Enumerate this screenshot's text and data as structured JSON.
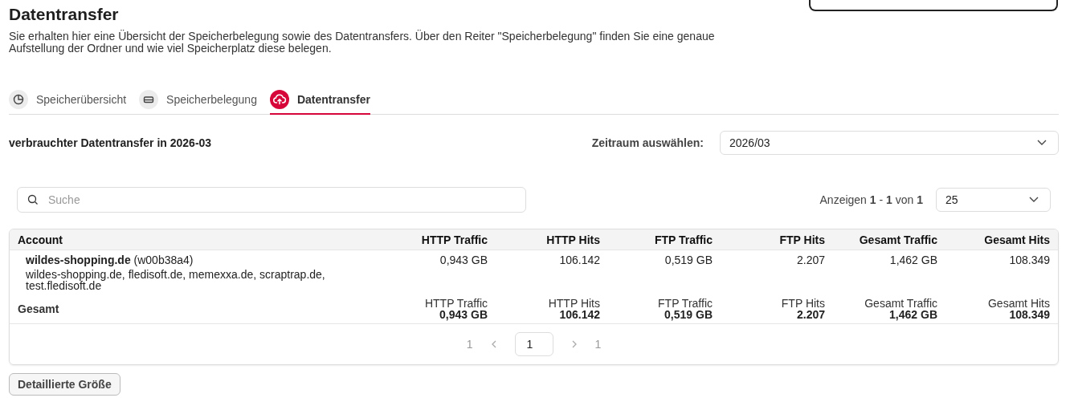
{
  "page": {
    "title": "Datentransfer",
    "description": "Sie erhalten hier eine Übersicht der Speicherbelegung sowie des Datentransfers. Über den Reiter \"Speicherbelegung\" finden Sie eine genaue Aufstellung der Ordner und wie viel Speicherplatz diese belegen."
  },
  "tabs": [
    {
      "label": "Speicherübersicht",
      "kind": "pie",
      "selected": false
    },
    {
      "label": "Speicherbelegung",
      "kind": "drive",
      "selected": false
    },
    {
      "label": "Datentransfer",
      "kind": "upload",
      "selected": true
    }
  ],
  "section": {
    "heading": "verbrauchter Datentransfer in 2026-03",
    "period_label": "Zeitraum auswählen:",
    "period_value": "2026/03"
  },
  "search": {
    "placeholder": "Suche"
  },
  "paging": {
    "summary": "Anzeigen **1** - **1** von **1**",
    "page_size": "25"
  },
  "table": {
    "columns": [
      "Account",
      "HTTP Traffic",
      "HTTP Hits",
      "FTP Traffic",
      "FTP Hits",
      "Gesamt Traffic",
      "Gesamt Hits"
    ],
    "rows": [
      {
        "account": "wildes-shopping.de",
        "id": "(w00b38a4)",
        "domains": "wildes-shopping.de, fledisoft.de, memexxa.de, scraptrap.de, test.fledisoft.de",
        "values": [
          "0,943 GB",
          "106.142",
          "0,519 GB",
          "2.207",
          "1,462 GB",
          "108.349"
        ]
      }
    ],
    "totals": {
      "label": "Gesamt",
      "cells": [
        {
          "label": "HTTP Traffic",
          "value": "0,943 GB"
        },
        {
          "label": "HTTP Hits",
          "value": "106.142"
        },
        {
          "label": "FTP Traffic",
          "value": "0,519 GB"
        },
        {
          "label": "FTP Hits",
          "value": "2.207"
        },
        {
          "label": "Gesamt Traffic",
          "value": "1,462 GB"
        },
        {
          "label": "Gesamt Hits",
          "value": "108.349"
        }
      ]
    }
  },
  "pagination": {
    "first": "1",
    "current": "1",
    "last": "1"
  },
  "button": "Detaillierte Größe"
}
